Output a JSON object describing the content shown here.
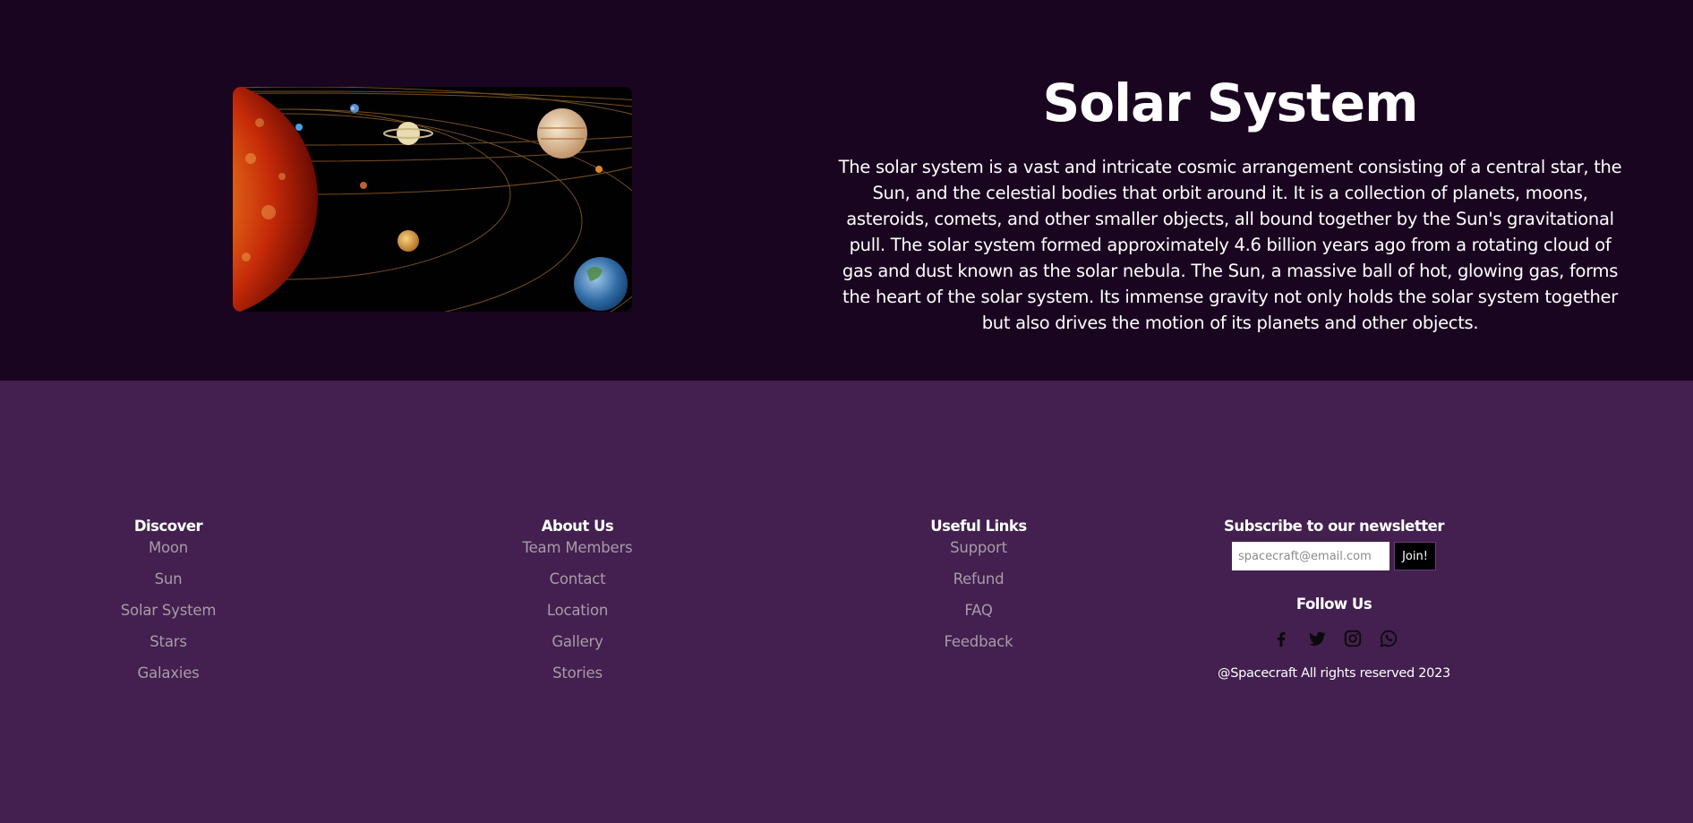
{
  "hero": {
    "title": "Solar System",
    "description": "The solar system is a vast and intricate cosmic arrangement consisting of a central star, the Sun, and the celestial bodies that orbit around it. It is a collection of planets, moons, asteroids, comets, and other smaller objects, all bound together by the Sun's gravitational pull. The solar system formed approximately 4.6 billion years ago from a rotating cloud of gas and dust known as the solar nebula. The Sun, a massive ball of hot, glowing gas, forms the heart of the solar system. Its immense gravity not only holds the solar system together but also drives the motion of its planets and other objects.",
    "image_icon": "solar-system-image"
  },
  "footer": {
    "discover": {
      "heading": "Discover",
      "links": [
        "Moon",
        "Sun",
        "Solar System",
        "Stars",
        "Galaxies"
      ]
    },
    "about": {
      "heading": "About Us",
      "links": [
        "Team Members",
        "Contact",
        "Location",
        "Gallery",
        "Stories"
      ]
    },
    "useful": {
      "heading": "Useful Links",
      "links": [
        "Support",
        "Refund",
        "FAQ",
        "Feedback"
      ]
    },
    "newsletter": {
      "heading": "Subscribe to our newsletter",
      "placeholder": "spacecraft@email.com",
      "button_label": "Join!",
      "follow_heading": "Follow Us",
      "socials": [
        "facebook-icon",
        "twitter-icon",
        "instagram-icon",
        "whatsapp-icon"
      ],
      "copyright": "@Spacecraft All rights reserved 2023"
    }
  },
  "colors": {
    "hero_bg": "#1a0520",
    "footer_bg": "#43204f",
    "link": "#a89ba9",
    "button_bg": "#000000"
  }
}
